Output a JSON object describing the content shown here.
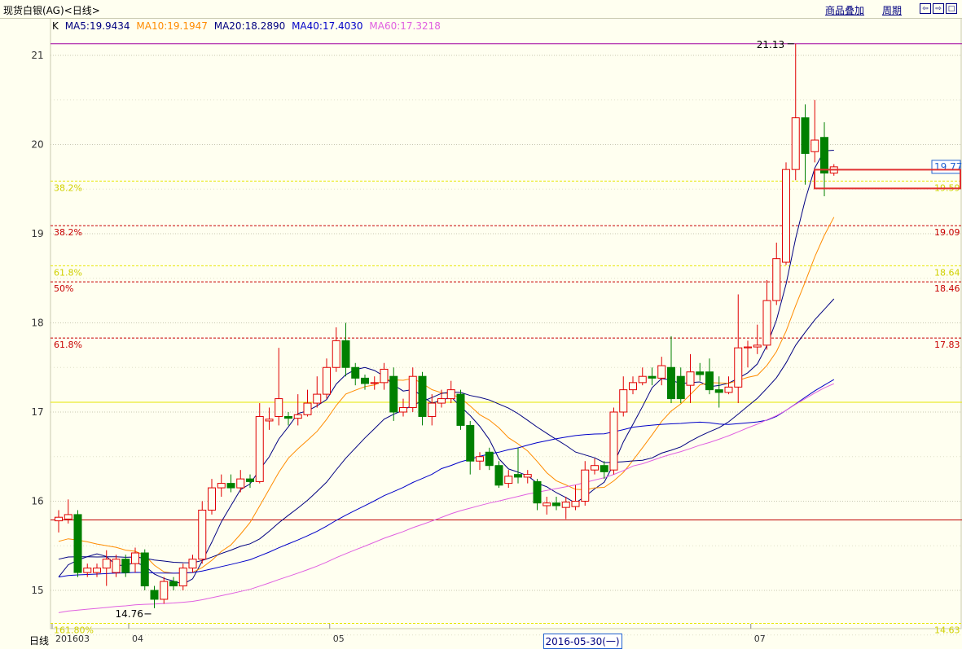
{
  "window": {
    "title": "现货白银(AG)<日线>",
    "overlay_link": "商品叠加",
    "period_link": "周期",
    "nav_icons": [
      "arrow-left-icon",
      "arrow-right-icon",
      "restore-icon"
    ]
  },
  "legend": {
    "k_label": "K",
    "ma5": "MA5:19.9434",
    "ma10": "MA10:19.1947",
    "ma20": "MA20:18.2890",
    "ma40": "MA40:17.4030",
    "ma60": "MA60:17.3218"
  },
  "colors": {
    "up": "#e00000",
    "down": "#008000",
    "ma5": "#000080",
    "ma10": "#ff8c00",
    "ma20": "#0000c8",
    "ma40": "#0000c8",
    "ma60": "#e060e0",
    "fib_yellow": "#e6e600",
    "fib_red": "#c80000",
    "highlight": "#e03030"
  },
  "annotations": {
    "high_label": "21.13",
    "low_label": "14.76",
    "price_box": "19.77",
    "cursor_date": "2016-05-30(一)",
    "bottom_left_label": "日线"
  },
  "chart_data": {
    "type": "candlestick",
    "title": "现货白银(AG)<日线>",
    "ylim": [
      14.6,
      21.2
    ],
    "y_ticks": [
      15,
      16,
      17,
      18,
      19,
      20,
      21
    ],
    "x_ticks": [
      {
        "label": "201603",
        "index": 0
      },
      {
        "label": "04",
        "index": 8
      },
      {
        "label": "05",
        "index": 29
      },
      {
        "label": "07",
        "index": 73
      }
    ],
    "grid": true,
    "horizontal_lines": [
      {
        "value": 21.13,
        "color": "#a000a0"
      },
      {
        "value": 17.11,
        "color": "#e6e600"
      },
      {
        "value": 15.79,
        "color": "#c00000"
      }
    ],
    "fib_levels": [
      {
        "value": 19.59,
        "left_label": "38.2%",
        "right_label": "19.59",
        "color": "yellow"
      },
      {
        "value": 19.09,
        "left_label": "38.2%",
        "right_label": "19.09",
        "color": "red"
      },
      {
        "value": 18.64,
        "left_label": "61.8%",
        "right_label": "18.64",
        "color": "yellow"
      },
      {
        "value": 18.46,
        "left_label": "50%",
        "right_label": "18.46",
        "color": "red"
      },
      {
        "value": 17.83,
        "left_label": "61.8%",
        "right_label": "17.83",
        "color": "red"
      },
      {
        "value": 14.63,
        "left_label": "161.80%",
        "right_label": "14.63",
        "color": "yellow"
      }
    ],
    "candles": [
      [
        15.78,
        15.82,
        15.65,
        15.9
      ],
      [
        15.8,
        15.85,
        15.75,
        16.02
      ],
      [
        15.85,
        15.2,
        15.15,
        15.9
      ],
      [
        15.2,
        15.25,
        15.15,
        15.3
      ],
      [
        15.2,
        15.25,
        15.15,
        15.3
      ],
      [
        15.25,
        15.35,
        15.05,
        15.45
      ],
      [
        15.2,
        15.35,
        15.15,
        15.4
      ],
      [
        15.35,
        15.2,
        15.15,
        15.4
      ],
      [
        15.3,
        15.42,
        15.2,
        15.48
      ],
      [
        15.42,
        15.05,
        15.0,
        15.46
      ],
      [
        15.0,
        14.9,
        14.8,
        15.05
      ],
      [
        14.9,
        15.1,
        14.85,
        15.15
      ],
      [
        15.1,
        15.05,
        15.0,
        15.15
      ],
      [
        15.05,
        15.25,
        15.0,
        15.3
      ],
      [
        15.25,
        15.35,
        15.2,
        15.4
      ],
      [
        15.35,
        15.9,
        15.3,
        16.0
      ],
      [
        15.9,
        16.15,
        15.85,
        16.25
      ],
      [
        16.15,
        16.2,
        16.05,
        16.3
      ],
      [
        16.2,
        16.15,
        16.1,
        16.3
      ],
      [
        16.15,
        16.25,
        16.1,
        16.35
      ],
      [
        16.25,
        16.22,
        16.15,
        16.3
      ],
      [
        16.22,
        16.95,
        16.2,
        17.1
      ],
      [
        16.9,
        16.92,
        16.8,
        17.05
      ],
      [
        16.95,
        17.15,
        16.85,
        17.72
      ],
      [
        16.95,
        16.93,
        16.85,
        17.0
      ],
      [
        16.93,
        16.97,
        16.85,
        17.2
      ],
      [
        16.97,
        17.1,
        16.95,
        17.25
      ],
      [
        17.1,
        17.2,
        17.05,
        17.4
      ],
      [
        17.2,
        17.5,
        17.15,
        17.6
      ],
      [
        17.5,
        17.8,
        17.45,
        17.95
      ],
      [
        17.8,
        17.5,
        17.4,
        18.0
      ],
      [
        17.5,
        17.38,
        17.3,
        17.55
      ],
      [
        17.38,
        17.32,
        17.25,
        17.42
      ],
      [
        17.32,
        17.33,
        17.25,
        17.4
      ],
      [
        17.33,
        17.48,
        17.25,
        17.55
      ],
      [
        17.4,
        17.0,
        16.9,
        17.5
      ],
      [
        17.0,
        17.05,
        16.95,
        17.15
      ],
      [
        17.05,
        17.4,
        17.0,
        17.5
      ],
      [
        17.4,
        16.95,
        16.85,
        17.45
      ],
      [
        16.95,
        17.1,
        16.85,
        17.2
      ],
      [
        17.1,
        17.15,
        17.05,
        17.25
      ],
      [
        17.15,
        17.25,
        17.1,
        17.35
      ],
      [
        17.2,
        16.85,
        16.8,
        17.25
      ],
      [
        16.85,
        16.45,
        16.3,
        16.9
      ],
      [
        16.45,
        16.5,
        16.35,
        16.55
      ],
      [
        16.55,
        16.4,
        16.35,
        16.6
      ],
      [
        16.4,
        16.18,
        16.15,
        16.45
      ],
      [
        16.2,
        16.28,
        16.15,
        16.35
      ],
      [
        16.3,
        16.27,
        16.2,
        16.6
      ],
      [
        16.27,
        16.3,
        16.2,
        16.35
      ],
      [
        16.22,
        15.98,
        15.9,
        16.25
      ],
      [
        15.95,
        15.98,
        15.85,
        16.05
      ],
      [
        15.98,
        15.95,
        15.9,
        16.05
      ],
      [
        15.93,
        15.99,
        15.8,
        16.05
      ],
      [
        15.94,
        16.0,
        15.9,
        16.18
      ],
      [
        16.0,
        16.35,
        15.95,
        16.45
      ],
      [
        16.35,
        16.4,
        16.3,
        16.48
      ],
      [
        16.4,
        16.33,
        16.25,
        16.45
      ],
      [
        16.35,
        17.0,
        16.3,
        17.05
      ],
      [
        17.0,
        17.25,
        16.95,
        17.4
      ],
      [
        17.25,
        17.33,
        17.2,
        17.4
      ],
      [
        17.33,
        17.4,
        17.3,
        17.5
      ],
      [
        17.4,
        17.38,
        17.3,
        17.5
      ],
      [
        17.38,
        17.52,
        17.3,
        17.62
      ],
      [
        17.5,
        17.15,
        17.1,
        17.85
      ],
      [
        17.4,
        17.15,
        17.1,
        17.5
      ],
      [
        17.3,
        17.45,
        17.1,
        17.65
      ],
      [
        17.45,
        17.42,
        17.35,
        17.55
      ],
      [
        17.45,
        17.25,
        17.2,
        17.6
      ],
      [
        17.25,
        17.22,
        17.05,
        17.4
      ],
      [
        17.22,
        17.28,
        17.2,
        17.4
      ],
      [
        17.28,
        17.72,
        17.1,
        18.32
      ],
      [
        17.72,
        17.73,
        17.5,
        17.8
      ],
      [
        17.73,
        17.75,
        17.65,
        17.98
      ],
      [
        17.75,
        18.25,
        17.7,
        18.48
      ],
      [
        18.25,
        18.72,
        18.2,
        18.9
      ],
      [
        18.68,
        19.72,
        18.65,
        19.8
      ],
      [
        19.72,
        20.3,
        19.6,
        21.13
      ],
      [
        20.3,
        19.9,
        19.55,
        20.45
      ],
      [
        19.92,
        20.05,
        19.8,
        20.5
      ],
      [
        20.08,
        19.68,
        19.42,
        20.25
      ],
      [
        19.68,
        19.75,
        19.65,
        19.78
      ]
    ],
    "ma_values": {
      "ma5_first": 15.15,
      "ma5_last": 19.94,
      "ma10_first": 15.55,
      "ma10_last": 19.19,
      "ma20_first": 15.35,
      "ma20_last": 18.29,
      "ma40_first": 15.15,
      "ma40_last": 17.4,
      "ma60_first": 14.75,
      "ma60_last": 17.32
    }
  }
}
